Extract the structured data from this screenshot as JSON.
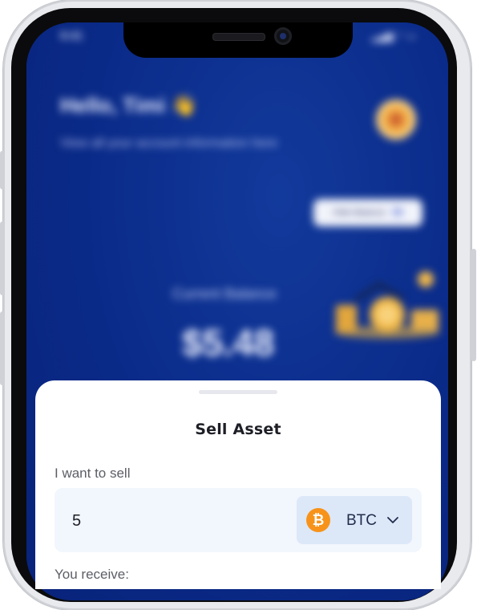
{
  "status_bar": {
    "time": "9:41",
    "icons": "▂▄▆ ◠ ▭"
  },
  "home": {
    "greeting": "Hello, Timi 👋",
    "subtitle": "View all your account information here",
    "hide_balance_label": "Hide Balance",
    "current_balance_label": "Current Balance",
    "balance": "$5.48"
  },
  "sell_sheet": {
    "title": "Sell Asset",
    "sell_label": "I want to sell",
    "amount_value": "5",
    "selected_asset": "BTC",
    "asset_icon_glyph": "₿",
    "asset_icon_color": "#f7931a",
    "receive_label": "You receive:"
  },
  "colors": {
    "screen_blue": "#0a2a8a",
    "input_bg": "#f2f6fd",
    "select_bg": "#dce8f8"
  }
}
